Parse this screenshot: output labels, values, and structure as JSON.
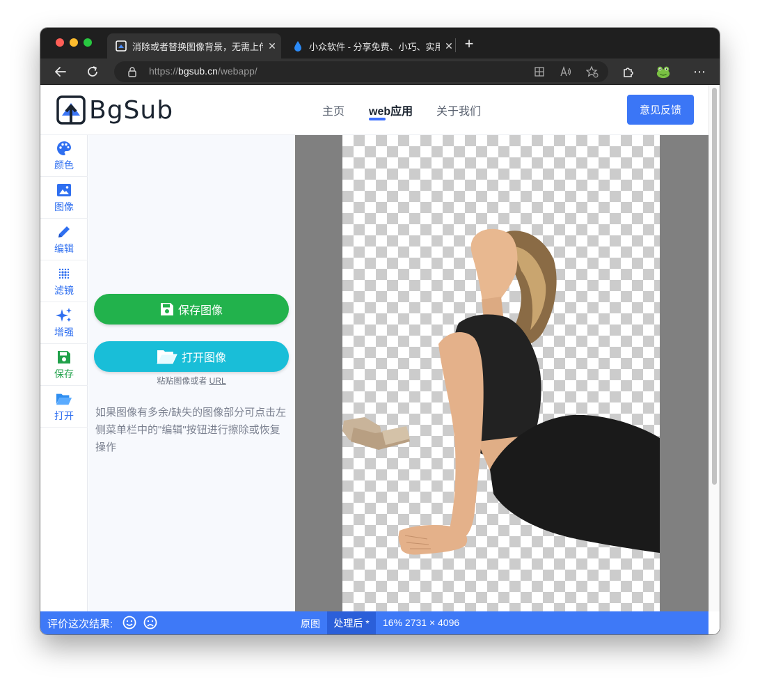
{
  "browser": {
    "tabs": [
      {
        "title": "消除或者替换图像背景，无需上传"
      },
      {
        "title": "小众软件 - 分享免费、小巧、实用"
      }
    ],
    "url_scheme": "https://",
    "url_host": "bgsub.cn",
    "url_path": "/webapp/"
  },
  "header": {
    "logo_text": "BgSub",
    "nav": [
      "主页",
      "web应用",
      "关于我们"
    ],
    "feedback_label": "意见反馈"
  },
  "sidebar": {
    "items": [
      {
        "label": "颜色",
        "icon": "palette-icon"
      },
      {
        "label": "图像",
        "icon": "image-icon"
      },
      {
        "label": "编辑",
        "icon": "pencil-icon"
      },
      {
        "label": "滤镜",
        "icon": "dots-grid-icon"
      },
      {
        "label": "增强",
        "icon": "sparkles-icon"
      },
      {
        "label": "保存",
        "icon": "floppy-icon"
      },
      {
        "label": "打开",
        "icon": "folder-open-icon"
      }
    ]
  },
  "panel": {
    "save_label": "保存图像",
    "open_label": "打开图像",
    "paste_text": "粘贴图像或者",
    "paste_link": "URL",
    "hint": "如果图像有多余/缺失的图像部分可点击左侧菜单栏中的\"编辑\"按钮进行擦除或恢复操作"
  },
  "statusbar": {
    "rate_label": "评价这次结果:",
    "original_label": "原图",
    "processed_label": "处理后 *",
    "info": "16% 2731 × 4096"
  },
  "colors": {
    "accent": "#3e79f7",
    "save_green": "#22b24c",
    "open_cyan": "#19bed8"
  }
}
